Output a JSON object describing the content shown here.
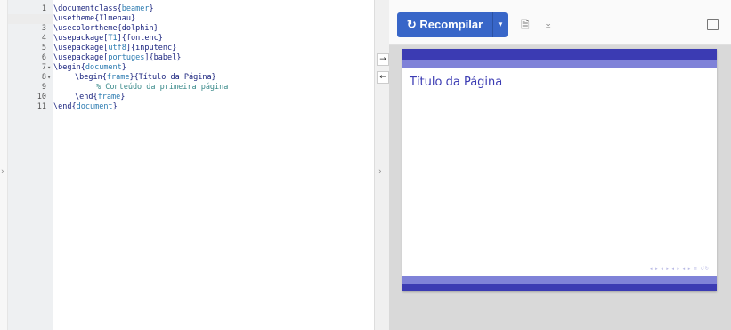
{
  "editor": {
    "lines": [
      {
        "n": "1",
        "fold": ""
      },
      {
        "n": "2",
        "fold": ""
      },
      {
        "n": "3",
        "fold": ""
      },
      {
        "n": "4",
        "fold": ""
      },
      {
        "n": "5",
        "fold": ""
      },
      {
        "n": "6",
        "fold": ""
      },
      {
        "n": "7",
        "fold": "▾"
      },
      {
        "n": "8",
        "fold": "▾"
      },
      {
        "n": "9",
        "fold": ""
      },
      {
        "n": "10",
        "fold": ""
      },
      {
        "n": "11",
        "fold": ""
      }
    ],
    "code": {
      "l1_cmd": "\\documentclass",
      "l1_arg": "beamer",
      "l2_cmd": "\\usetheme",
      "l2_arg": "Ilmenau",
      "l3_cmd": "\\usecolortheme",
      "l3_arg": "dolphin",
      "l4_cmd": "\\usepackage",
      "l4_opt": "T1",
      "l4_arg": "fontenc",
      "l5_cmd": "\\usepackage",
      "l5_opt": "utf8",
      "l5_arg": "inputenc",
      "l6_cmd": "\\usepackage",
      "l6_opt": "portuges",
      "l6_arg": "babel",
      "l7_cmd": "\\begin",
      "l7_arg": "document",
      "l8_cmd": "\\begin",
      "l8_arg": "frame",
      "l8_text": "{Título da Página}",
      "l9_comment": "% Conteúdo da primeira página",
      "l10_cmd": "\\end",
      "l10_arg": "frame",
      "l11_cmd": "\\end",
      "l11_arg": "document"
    }
  },
  "toolbar": {
    "recompile_icon": "↻",
    "recompile_label": "Recompilar",
    "dropdown_caret": "▼",
    "logs_icon": "🗎",
    "download_icon": "⤓"
  },
  "collapse": {
    "left_arrow": "›",
    "mid_arrow": "›",
    "swap_right": "→",
    "swap_left": "←"
  },
  "slide": {
    "title": "Título da Página",
    "nav_symbols": "◂ ▸ ◂ ▸ ◂ ▸ ◂ ▸   ≡   ↺↻"
  },
  "colors": {
    "accent": "#3866c8",
    "slide_dark": "#3b3bb3",
    "slide_light": "#7f82d8"
  }
}
